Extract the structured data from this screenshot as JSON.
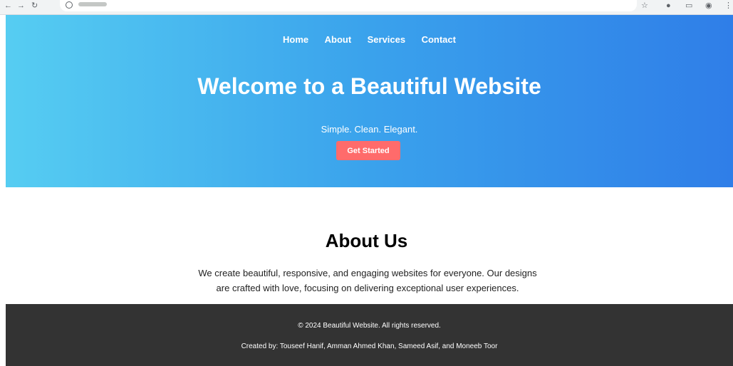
{
  "colors": {
    "hero_gradient_start": "#56cdf2",
    "hero_gradient_end": "#2f7ee8",
    "cta_background": "#ff6b6b",
    "footer_background": "#333333"
  },
  "nav": {
    "items": [
      "Home",
      "About",
      "Services",
      "Contact"
    ]
  },
  "hero": {
    "title": "Welcome to a Beautiful Website",
    "subtitle": "Simple. Clean. Elegant.",
    "cta_label": "Get Started"
  },
  "about": {
    "title": "About Us",
    "text": "We create beautiful, responsive, and engaging websites for everyone. Our designs are crafted with love, focusing on delivering exceptional user experiences."
  },
  "footer": {
    "copyright": "© 2024 Beautiful Website. All rights reserved.",
    "credits": "Created by: Touseef Hanif, Amman Ahmed Khan, Sameed Asif, and Moneeb Toor"
  },
  "browser": {
    "icons": [
      "site-info-icon",
      "bookmark-star-icon",
      "extension-icon",
      "menu-dots-icon"
    ]
  }
}
